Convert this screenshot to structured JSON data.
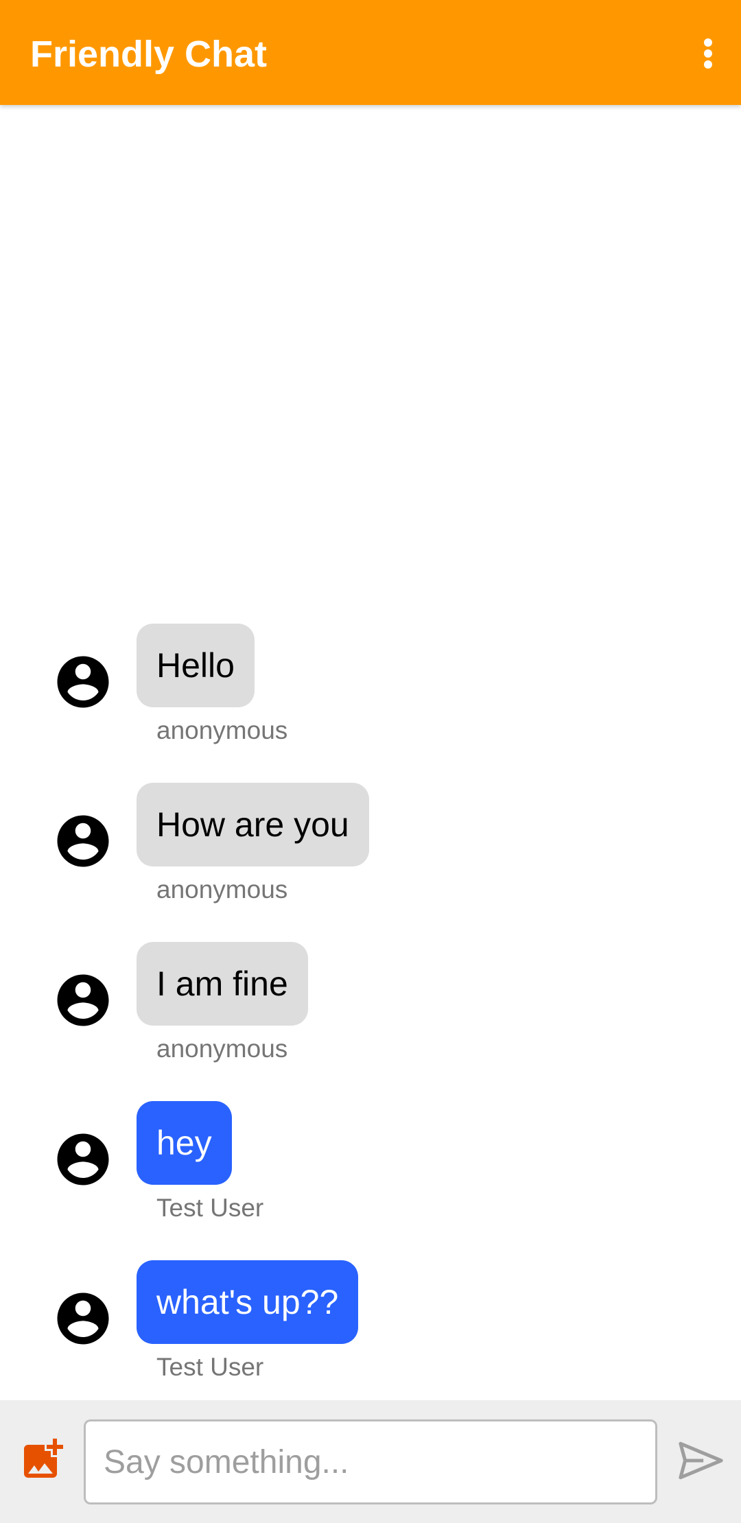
{
  "app_bar": {
    "title": "Friendly Chat",
    "background_color": "#FF9800",
    "menu_icon": "more-vert-icon"
  },
  "messages": [
    {
      "text": "Hello",
      "sender": "anonymous",
      "style": "other",
      "avatar_icon": "account-circle-icon"
    },
    {
      "text": "How are you",
      "sender": "anonymous",
      "style": "other",
      "avatar_icon": "account-circle-icon"
    },
    {
      "text": "I am fine",
      "sender": "anonymous",
      "style": "other",
      "avatar_icon": "account-circle-icon"
    },
    {
      "text": "hey",
      "sender": "Test User",
      "style": "self",
      "avatar_icon": "account-circle-icon"
    },
    {
      "text": "what's up??",
      "sender": "Test User",
      "style": "self",
      "avatar_icon": "account-circle-icon"
    }
  ],
  "colors": {
    "other_bubble": "#DDDDDD",
    "self_bubble": "#2962FF",
    "sender_text": "#757575",
    "add_image_icon": "#E65100",
    "send_icon_disabled": "#9E9E9E"
  },
  "composer": {
    "placeholder": "Say something...",
    "value": "",
    "add_image_icon": "add-photo-icon",
    "send_icon": "send-icon",
    "send_enabled": false
  }
}
